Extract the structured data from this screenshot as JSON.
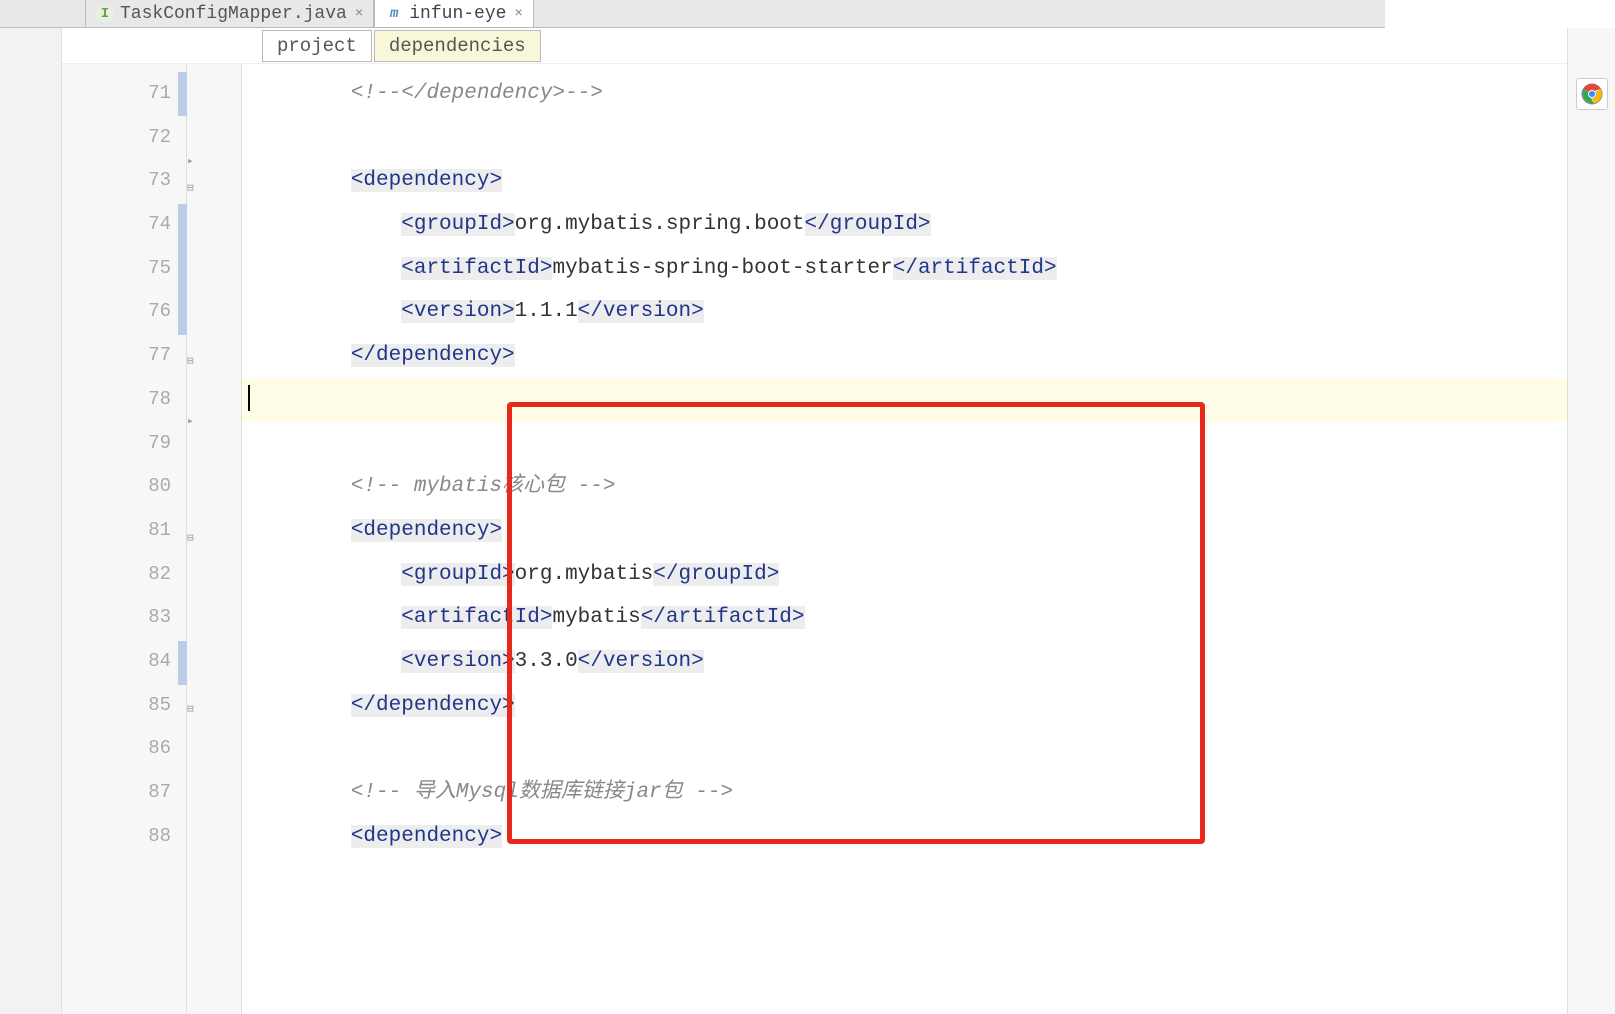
{
  "tabs": [
    {
      "label": "TaskConfigMapper.java",
      "icon": "java",
      "active": false
    },
    {
      "label": "infun-eye",
      "icon": "maven",
      "active": true
    }
  ],
  "breadcrumbs": {
    "b0": "project",
    "b1": "dependencies"
  },
  "lines": {
    "start": 71,
    "l71": "<!--</dependency>-->",
    "l72": "",
    "l73_open": "<dependency>",
    "l74_tag1": "<groupId>",
    "l74_text": "org.mybatis.spring.boot",
    "l74_tag2": "</groupId>",
    "l75_tag1": "<artifactId>",
    "l75_text": "mybatis-spring-boot-starter",
    "l75_tag2": "</artifactId>",
    "l76_tag1": "<version>",
    "l76_text": "1.1.1",
    "l76_tag2": "</version>",
    "l77_close": "</dependency>",
    "l78": "",
    "l79": "",
    "l80_comment": "<!-- mybatis核心包 -->",
    "l81_open": "<dependency>",
    "l82_tag1": "<groupId>",
    "l82_text": "org.mybatis",
    "l82_tag2": "</groupId>",
    "l83_tag1": "<artifactId>",
    "l83_text": "mybatis",
    "l83_tag2": "</artifactId>",
    "l84_tag1": "<version>",
    "l84_text": "3.3.0",
    "l84_tag2": "</version>",
    "l85_close": "</dependency>",
    "l86": "",
    "l87_comment": "<!-- 导入Mysql数据库链接jar包 -->",
    "l88_open": "<dependency>"
  },
  "line_numbers": [
    "71",
    "72",
    "73",
    "74",
    "75",
    "76",
    "77",
    "78",
    "79",
    "80",
    "81",
    "82",
    "83",
    "84",
    "85",
    "86",
    "87",
    "88"
  ]
}
